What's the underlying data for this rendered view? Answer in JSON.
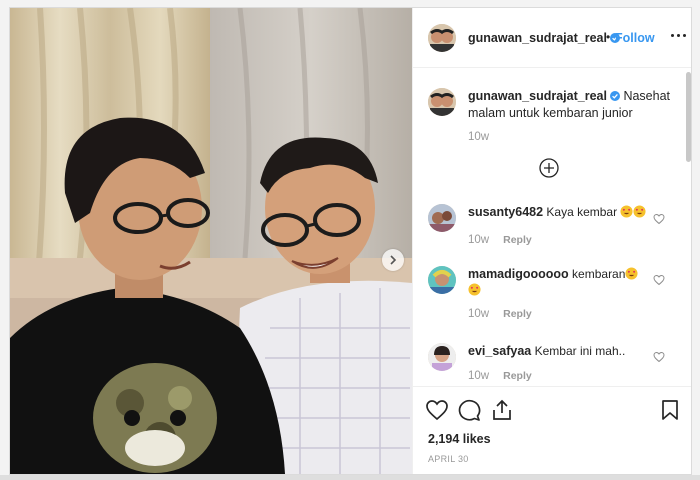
{
  "post": {
    "username": "gunawan_sudrajat_real",
    "follow_label": "Follow",
    "separator": "•",
    "caption": "Nasehat malam untuk kembaran junior",
    "caption_time": "10w",
    "comments": [
      {
        "username": "susanty6482",
        "text": "Kaya kembar",
        "time": "10w",
        "reply_label": "Reply"
      },
      {
        "username": "mamadigoooooo",
        "text": "kembaran",
        "time": "10w",
        "reply_label": "Reply"
      },
      {
        "username": "evi_safyaa",
        "text": "Kembar ini mah..",
        "time": "10w",
        "reply_label": "Reply"
      }
    ],
    "likes": "2,194 likes",
    "date": "APRIL 30"
  },
  "colors": {
    "link": "#3897f0",
    "verified": "#3897f0",
    "muted": "#999999",
    "text": "#262626"
  },
  "icons": [
    "verified-badge-icon",
    "more-options-icon",
    "load-more-comments-icon",
    "heart-icon",
    "like-icon",
    "comment-icon",
    "share-icon",
    "save-bookmark-icon",
    "carousel-next-icon",
    "heart-eyes-emoji"
  ]
}
